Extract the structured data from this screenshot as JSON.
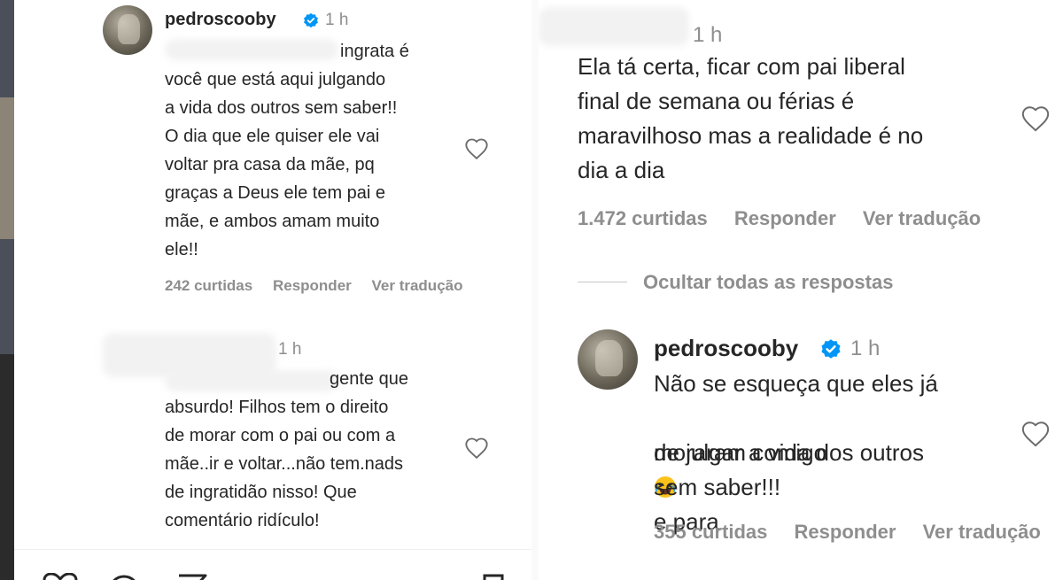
{
  "left": {
    "comment1": {
      "username": "pedroscooby",
      "time": "1 h",
      "text_line1": "ingrata é",
      "text_rest": "você que está aqui julgando\na vida dos outros sem saber!!\nO dia que ele quiser ele vai\nvoltar pra casa da mãe, pq\ngraças a Deus ele tem pai e\nmãe, e ambos amam muito\nele!!",
      "likes": "242 curtidas",
      "reply": "Responder",
      "translate": "Ver tradução"
    },
    "comment2": {
      "time": "1 h",
      "text_line1": "gente que",
      "text_rest": "absurdo! Filhos tem o direito\nde morar com o pai ou com a\nmãe..ir e voltar...não tem.nads\nde ingratidão nisso! Que\ncomentário ridículo!"
    }
  },
  "right": {
    "comment1": {
      "time": "1 h",
      "text": "Ela tá certa, ficar com pai liberal\nfinal de semana ou férias é\nmaravilhoso mas a realidade é no\ndia a dia",
      "likes": "1.472 curtidas",
      "reply": "Responder",
      "translate": "Ver tradução"
    },
    "hide_replies": "Ocultar todas as respostas",
    "comment2": {
      "username": "pedroscooby",
      "time": "1 h",
      "text_line1": "Não se esqueça que eles já",
      "text_line2_a": "moraram comigo",
      "text_line2_b": " e para",
      "text_rest": "de julgar a vida dos outros\nsem saber!!!",
      "likes": "355 curtidas",
      "reply": "Responder",
      "translate": "Ver tradução"
    }
  },
  "icons": [
    "verified-badge-icon",
    "heart-icon",
    "comment-icon",
    "share-icon",
    "bookmark-icon",
    "laughing-emoji-icon"
  ],
  "colors": {
    "verified": "#0095f6",
    "muted": "#8e8e8e",
    "text": "#262626"
  }
}
